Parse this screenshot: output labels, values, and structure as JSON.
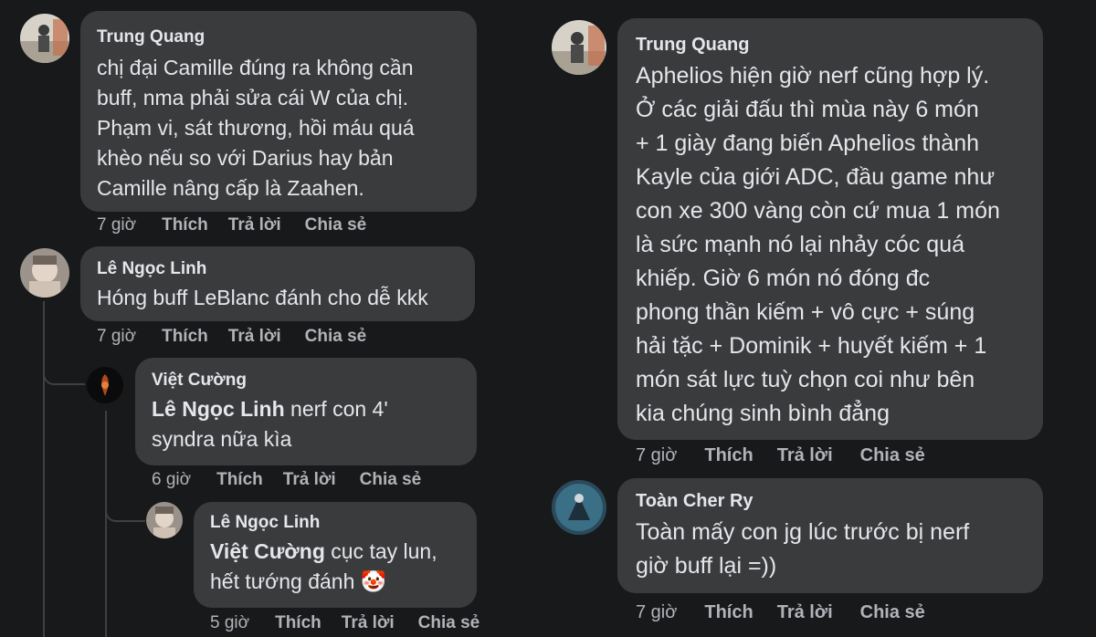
{
  "left": {
    "c1": {
      "author": "Trung Quang",
      "lines": [
        "chị đại Camille đúng ra không cần",
        "buff, nma phải sửa cái W của chị.",
        "Phạm vi, sát thương, hồi máu quá",
        "khèo nếu so với Darius hay bản",
        "Camille nâng cấp là Zaahen."
      ],
      "time": "7 giờ",
      "like": "Thích",
      "reply": "Trả lời",
      "share": "Chia sẻ"
    },
    "c2": {
      "author": "Lê Ngọc Linh",
      "lines": [
        "Hóng buff LeBlanc đánh cho dễ kkk"
      ],
      "time": "7 giờ",
      "like": "Thích",
      "reply": "Trả lời",
      "share": "Chia sẻ"
    },
    "c3": {
      "author": "Việt Cường",
      "mention": "Lê Ngọc Linh",
      "line1_rest": " nerf con 4'",
      "line2": "syndra nữa kìa",
      "time": "6 giờ",
      "like": "Thích",
      "reply": "Trả lời",
      "share": "Chia sẻ"
    },
    "c4": {
      "author": "Lê Ngọc Linh",
      "mention": "Việt Cường",
      "line1_rest": " cục tay lun,",
      "line2": "hết tướng đánh 🤡",
      "time": "5 giờ",
      "like": "Thích",
      "reply": "Trả lời",
      "share": "Chia sẻ"
    }
  },
  "right": {
    "c1": {
      "author": "Trung Quang",
      "lines": [
        "Aphelios hiện giờ nerf cũng hợp lý.",
        "Ở các giải đấu thì mùa này 6 món",
        "+ 1 giày đang biến Aphelios thành",
        "Kayle của giới ADC, đầu game như",
        "con xe 300 vàng còn cứ mua 1 món",
        "là sức mạnh nó lại nhảy cóc quá",
        "khiếp. Giờ 6 món nó đóng đc",
        "phong thần kiếm + vô cực + súng",
        "hải tặc + Dominik + huyết kiếm + 1",
        "món sát lực tuỳ chọn coi như bên",
        "kia chúng sinh bình đẳng"
      ],
      "time": "7 giờ",
      "like": "Thích",
      "reply": "Trả lời",
      "share": "Chia sẻ"
    },
    "c2": {
      "author": "Toàn Cher Ry",
      "lines": [
        "Toàn mấy con jg lúc trước bị nerf",
        "giờ buff lại =))"
      ],
      "time": "7 giờ",
      "like": "Thích",
      "reply": "Trả lời",
      "share": "Chia sẻ"
    }
  }
}
